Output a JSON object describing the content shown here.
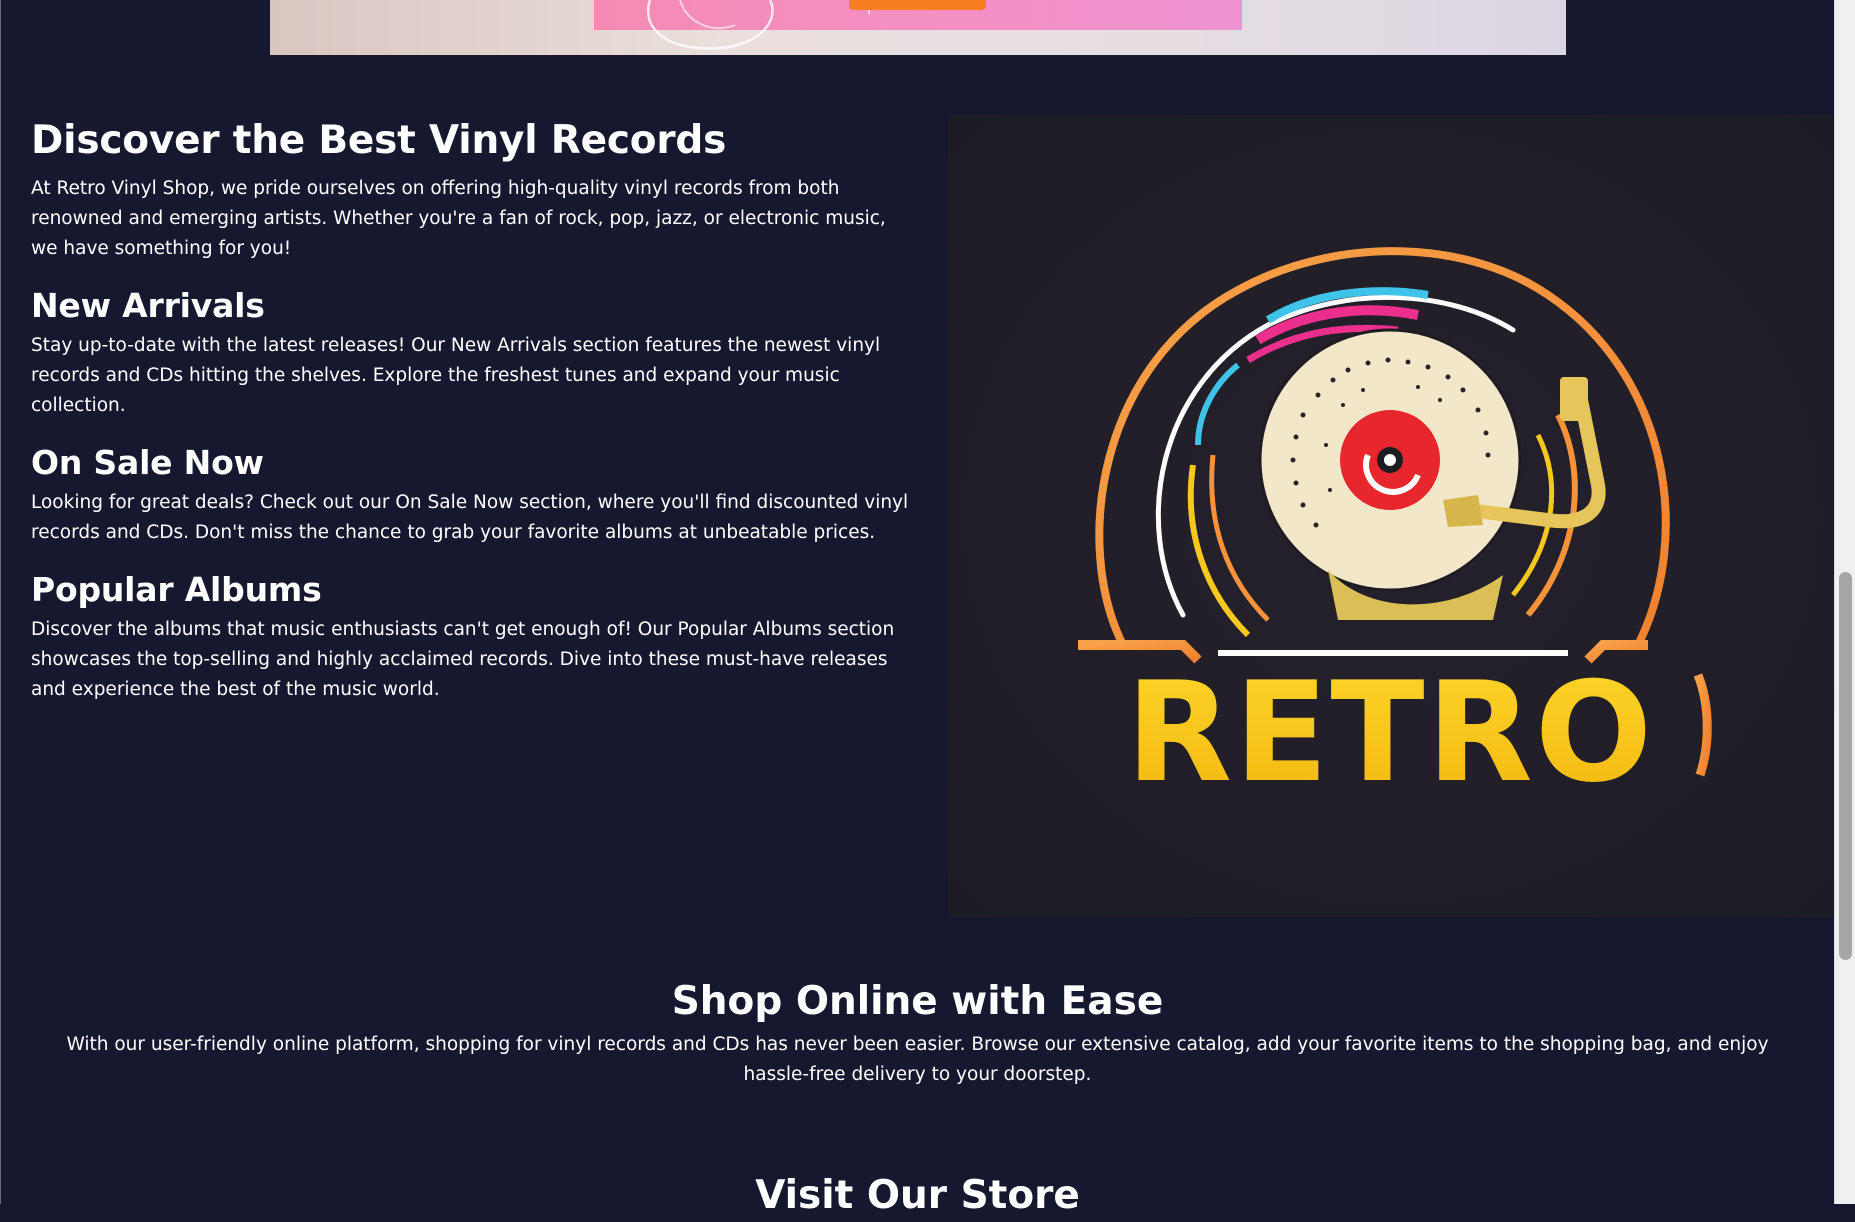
{
  "intro": {
    "title": "Discover the Best Vinyl Records",
    "text": "At Retro Vinyl Shop, we pride ourselves on offering high-quality vinyl records from both renowned and emerging artists. Whether you're a fan of rock, pop, jazz, or electronic music, we have something for you!"
  },
  "sections": [
    {
      "title": "New Arrivals",
      "text": "Stay up-to-date with the latest releases! Our New Arrivals section features the newest vinyl records and CDs hitting the shelves. Explore the freshest tunes and expand your music collection."
    },
    {
      "title": "On Sale Now",
      "text": "Looking for great deals? Check out our On Sale Now section, where you'll find discounted vinyl records and CDs. Don't miss the chance to grab your favorite albums at unbeatable prices."
    },
    {
      "title": "Popular Albums",
      "text": "Discover the albums that music enthusiasts can't get enough of! Our Popular Albums section showcases the top-selling and highly acclaimed records. Dive into these must-have releases and experience the best of the music world."
    }
  ],
  "logo": {
    "wordmark": "RETRO"
  },
  "shop": {
    "title": "Shop Online with Ease",
    "text": "With our user-friendly online platform, shopping for vinyl records and CDs has never been easier. Browse our extensive catalog, add your favorite items to the shopping bag, and enjoy hassle-free delivery to your doorstep."
  },
  "visit": {
    "title": "Visit Our Store"
  },
  "colors": {
    "background": "#161830",
    "text": "#ffffff",
    "logo_orange": "#f5923a",
    "logo_yellow": "#f7c81e",
    "logo_red": "#e8262d",
    "logo_pink": "#ec2e8c",
    "logo_cyan": "#3fc3e8",
    "hero_button": "#f57f1f"
  }
}
